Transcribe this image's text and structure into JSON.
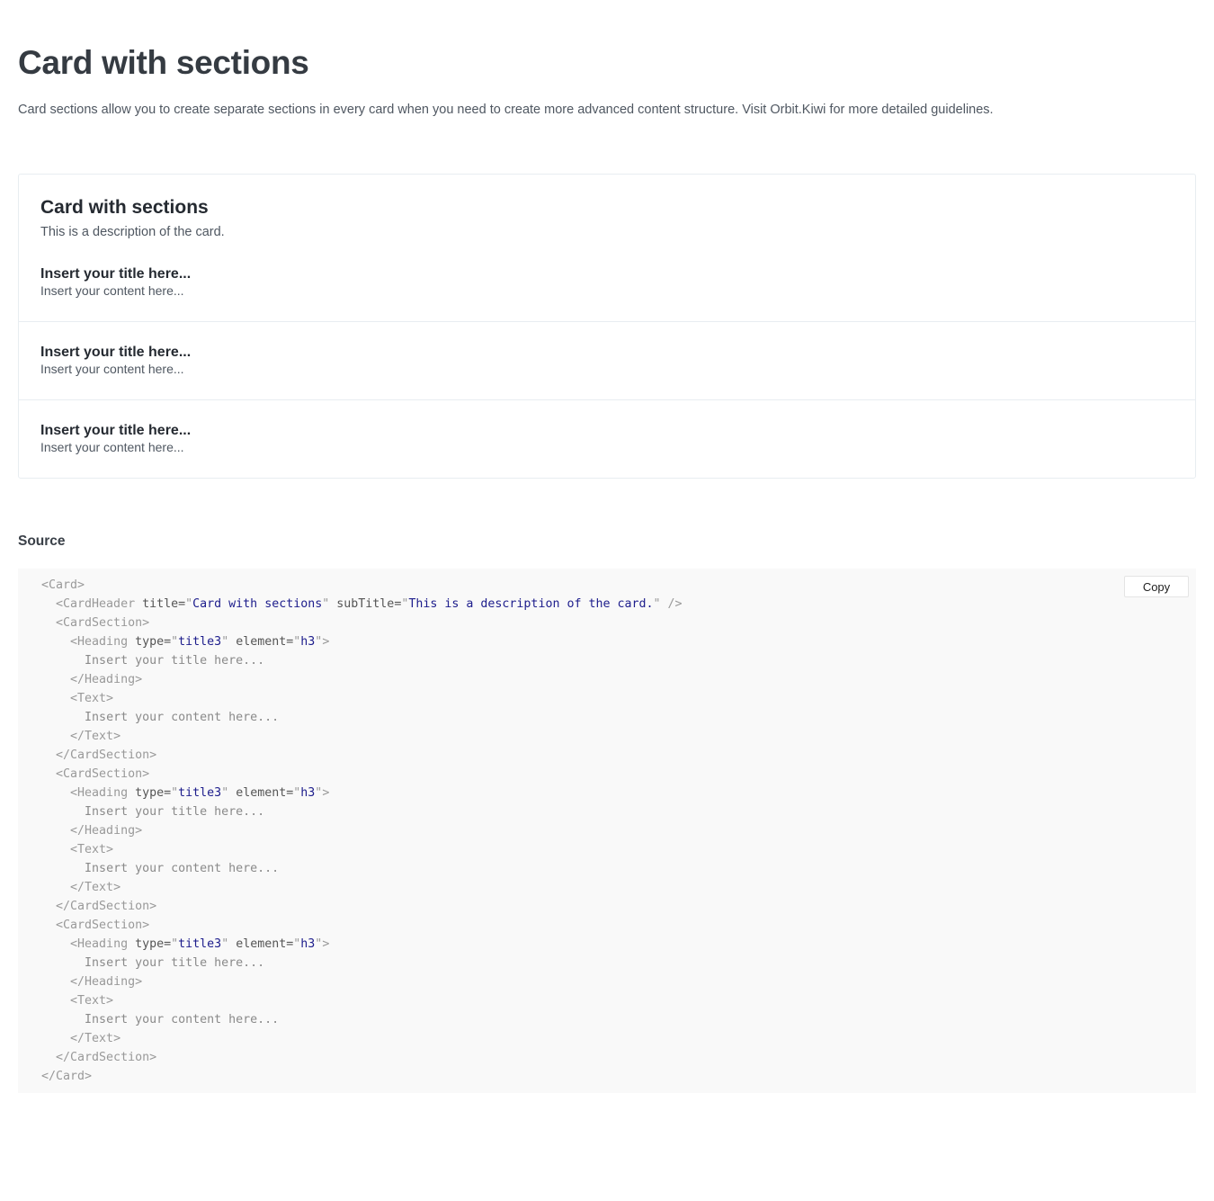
{
  "page": {
    "title": "Card with sections",
    "description": "Card sections allow you to create separate sections in every card when you need to create more advanced content structure. Visit Orbit.Kiwi for more detailed guidelines."
  },
  "card": {
    "title": "Card with sections",
    "subtitle": "This is a description of the card.",
    "sections": [
      {
        "title": "Insert your title here...",
        "content": "Insert your content here..."
      },
      {
        "title": "Insert your title here...",
        "content": "Insert your content here..."
      },
      {
        "title": "Insert your title here...",
        "content": "Insert your content here..."
      }
    ]
  },
  "source": {
    "label": "Source",
    "copy_label": "Copy",
    "code_lines": [
      {
        "indent": "",
        "tokens": [
          [
            "tag",
            "<Card>"
          ]
        ]
      },
      {
        "indent": "  ",
        "tokens": [
          [
            "tag",
            "<CardHeader"
          ],
          [
            "attr",
            " title="
          ],
          [
            "tag",
            "\""
          ],
          [
            "val",
            "Card with sections"
          ],
          [
            "tag",
            "\""
          ],
          [
            "attr",
            " subTitle="
          ],
          [
            "tag",
            "\""
          ],
          [
            "val",
            "This is a description of the card."
          ],
          [
            "tag",
            "\""
          ],
          [
            "tag",
            " />"
          ]
        ]
      },
      {
        "indent": "  ",
        "tokens": [
          [
            "tag",
            "<CardSection>"
          ]
        ]
      },
      {
        "indent": "    ",
        "tokens": [
          [
            "tag",
            "<Heading"
          ],
          [
            "attr",
            " type="
          ],
          [
            "tag",
            "\""
          ],
          [
            "val",
            "title3"
          ],
          [
            "tag",
            "\""
          ],
          [
            "attr",
            " element="
          ],
          [
            "tag",
            "\""
          ],
          [
            "val",
            "h3"
          ],
          [
            "tag",
            "\""
          ],
          [
            "tag",
            ">"
          ]
        ]
      },
      {
        "indent": "      ",
        "tokens": [
          [
            "txt",
            "Insert your title here..."
          ]
        ]
      },
      {
        "indent": "    ",
        "tokens": [
          [
            "tag",
            "</Heading>"
          ]
        ]
      },
      {
        "indent": "    ",
        "tokens": [
          [
            "tag",
            "<Text>"
          ]
        ]
      },
      {
        "indent": "      ",
        "tokens": [
          [
            "txt",
            "Insert your content here..."
          ]
        ]
      },
      {
        "indent": "    ",
        "tokens": [
          [
            "tag",
            "</Text>"
          ]
        ]
      },
      {
        "indent": "  ",
        "tokens": [
          [
            "tag",
            "</CardSection>"
          ]
        ]
      },
      {
        "indent": "  ",
        "tokens": [
          [
            "tag",
            "<CardSection>"
          ]
        ]
      },
      {
        "indent": "    ",
        "tokens": [
          [
            "tag",
            "<Heading"
          ],
          [
            "attr",
            " type="
          ],
          [
            "tag",
            "\""
          ],
          [
            "val",
            "title3"
          ],
          [
            "tag",
            "\""
          ],
          [
            "attr",
            " element="
          ],
          [
            "tag",
            "\""
          ],
          [
            "val",
            "h3"
          ],
          [
            "tag",
            "\""
          ],
          [
            "tag",
            ">"
          ]
        ]
      },
      {
        "indent": "      ",
        "tokens": [
          [
            "txt",
            "Insert your title here..."
          ]
        ]
      },
      {
        "indent": "    ",
        "tokens": [
          [
            "tag",
            "</Heading>"
          ]
        ]
      },
      {
        "indent": "    ",
        "tokens": [
          [
            "tag",
            "<Text>"
          ]
        ]
      },
      {
        "indent": "      ",
        "tokens": [
          [
            "txt",
            "Insert your content here..."
          ]
        ]
      },
      {
        "indent": "    ",
        "tokens": [
          [
            "tag",
            "</Text>"
          ]
        ]
      },
      {
        "indent": "  ",
        "tokens": [
          [
            "tag",
            "</CardSection>"
          ]
        ]
      },
      {
        "indent": "  ",
        "tokens": [
          [
            "tag",
            "<CardSection>"
          ]
        ]
      },
      {
        "indent": "    ",
        "tokens": [
          [
            "tag",
            "<Heading"
          ],
          [
            "attr",
            " type="
          ],
          [
            "tag",
            "\""
          ],
          [
            "val",
            "title3"
          ],
          [
            "tag",
            "\""
          ],
          [
            "attr",
            " element="
          ],
          [
            "tag",
            "\""
          ],
          [
            "val",
            "h3"
          ],
          [
            "tag",
            "\""
          ],
          [
            "tag",
            ">"
          ]
        ]
      },
      {
        "indent": "      ",
        "tokens": [
          [
            "txt",
            "Insert your title here..."
          ]
        ]
      },
      {
        "indent": "    ",
        "tokens": [
          [
            "tag",
            "</Heading>"
          ]
        ]
      },
      {
        "indent": "    ",
        "tokens": [
          [
            "tag",
            "<Text>"
          ]
        ]
      },
      {
        "indent": "      ",
        "tokens": [
          [
            "txt",
            "Insert your content here..."
          ]
        ]
      },
      {
        "indent": "    ",
        "tokens": [
          [
            "tag",
            "</Text>"
          ]
        ]
      },
      {
        "indent": "  ",
        "tokens": [
          [
            "tag",
            "</CardSection>"
          ]
        ]
      },
      {
        "indent": "",
        "tokens": [
          [
            "tag",
            "</Card>"
          ]
        ]
      }
    ]
  }
}
